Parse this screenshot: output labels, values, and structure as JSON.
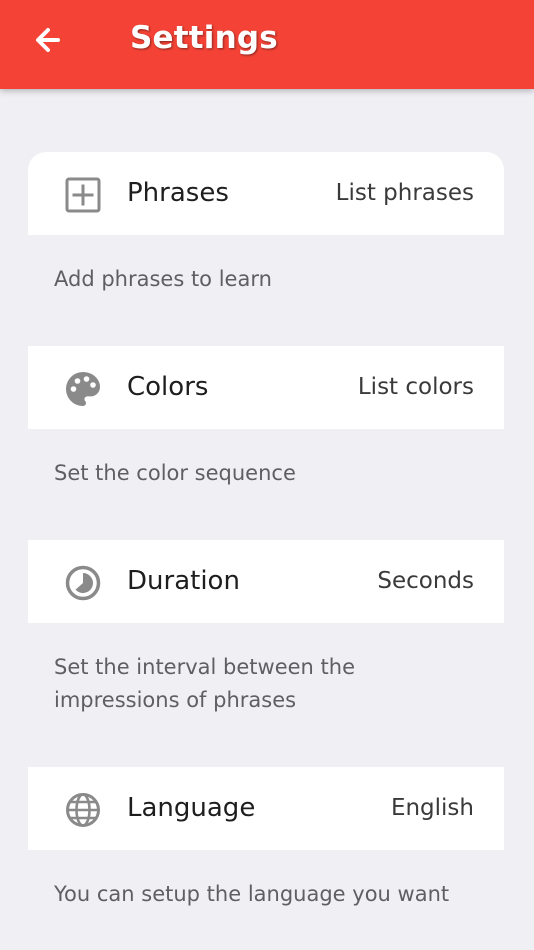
{
  "header": {
    "title": "Settings",
    "back_icon": "arrow-left-icon",
    "background_color": "#f44336"
  },
  "settings": [
    {
      "icon": "add-box-icon",
      "label": "Phrases",
      "value": "List phrases",
      "description": "Add phrases to learn"
    },
    {
      "icon": "palette-icon",
      "label": "Colors",
      "value": "List colors",
      "description": "Set the color sequence"
    },
    {
      "icon": "timelapse-icon",
      "label": "Duration",
      "value": "Seconds",
      "description": "Set the interval between the impressions of phrases"
    },
    {
      "icon": "globe-icon",
      "label": "Language",
      "value": "English",
      "description": "You can setup the language you want"
    }
  ],
  "colors": {
    "page_background": "#f0eff4",
    "card_background": "#ffffff",
    "icon_color": "#8a8a8a"
  }
}
